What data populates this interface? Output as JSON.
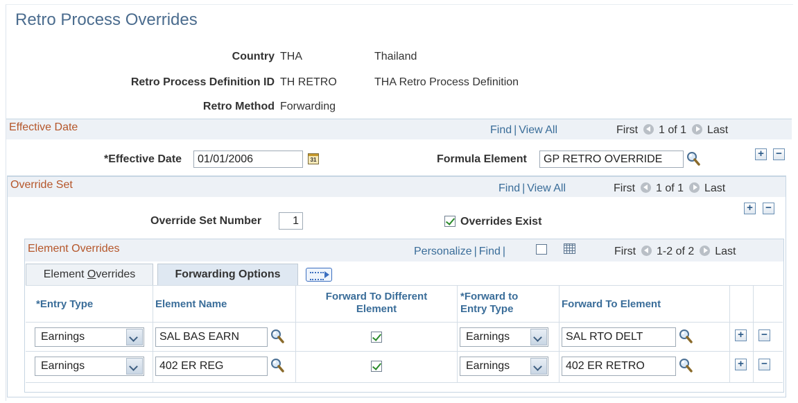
{
  "page": {
    "title": "Retro Process Overrides"
  },
  "header": {
    "country_label": "Country",
    "country_code": "THA",
    "country_name": "Thailand",
    "def_label": "Retro Process Definition ID",
    "def_id": "TH RETRO",
    "def_desc": "THA Retro Process Definition",
    "method_label": "Retro Method",
    "method_value": "Forwarding"
  },
  "effdate": {
    "title": "Effective Date",
    "find": "Find",
    "view_all": "View All",
    "first": "First",
    "count": "1 of 1",
    "last": "Last",
    "date_label": "*Effective Date",
    "date_value": "01/01/2006",
    "formula_label": "Formula Element",
    "formula_value": "GP RETRO OVERRIDE",
    "calendar_glyph": "31",
    "add": "+",
    "remove": "−"
  },
  "override_set": {
    "title": "Override Set",
    "find": "Find",
    "view_all": "View All",
    "first": "First",
    "count": "1 of 1",
    "last": "Last",
    "number_label": "Override Set Number",
    "number_value": "1",
    "exist_label": "Overrides Exist",
    "exist_checked": true,
    "add": "+",
    "remove": "−"
  },
  "element_overrides": {
    "title": "Element Overrides",
    "personalize": "Personalize",
    "find": "Find",
    "first": "First",
    "count": "1-2 of 2",
    "last": "Last",
    "tabs": [
      {
        "label": "Element Overrides",
        "active": false
      },
      {
        "label": "Forwarding Options",
        "active": true
      }
    ],
    "columns": {
      "entry_type": "*Entry Type",
      "element_name": "Element Name",
      "fwd_diff_1": "Forward To Different",
      "fwd_diff_2": "Element",
      "fwd_entry_1": "*Forward to",
      "fwd_entry_2": "Entry Type",
      "fwd_element": "Forward To Element"
    },
    "rows": [
      {
        "entry_type": "Earnings",
        "element_name": "SAL BAS EARN",
        "fwd_diff": true,
        "fwd_entry_type": "Earnings",
        "fwd_element": "SAL RTO DELT"
      },
      {
        "entry_type": "Earnings",
        "element_name": "402 ER REG",
        "fwd_diff": true,
        "fwd_entry_type": "Earnings",
        "fwd_element": "402 ER RETRO"
      }
    ],
    "add": "+",
    "remove": "−"
  },
  "colors": {
    "title": "#4b6c8e",
    "section_title": "#b5562a",
    "link": "#3a6d99",
    "section_bg": "#edf1f6"
  },
  "icons": [
    "calendar-icon",
    "lookup-icon",
    "add-row-icon",
    "delete-row-icon",
    "first-arrow-icon",
    "last-arrow-icon",
    "new-window-icon",
    "grid-download-icon",
    "show-all-columns-icon",
    "dropdown-arrow-icon",
    "checkbox-checked-icon"
  ]
}
